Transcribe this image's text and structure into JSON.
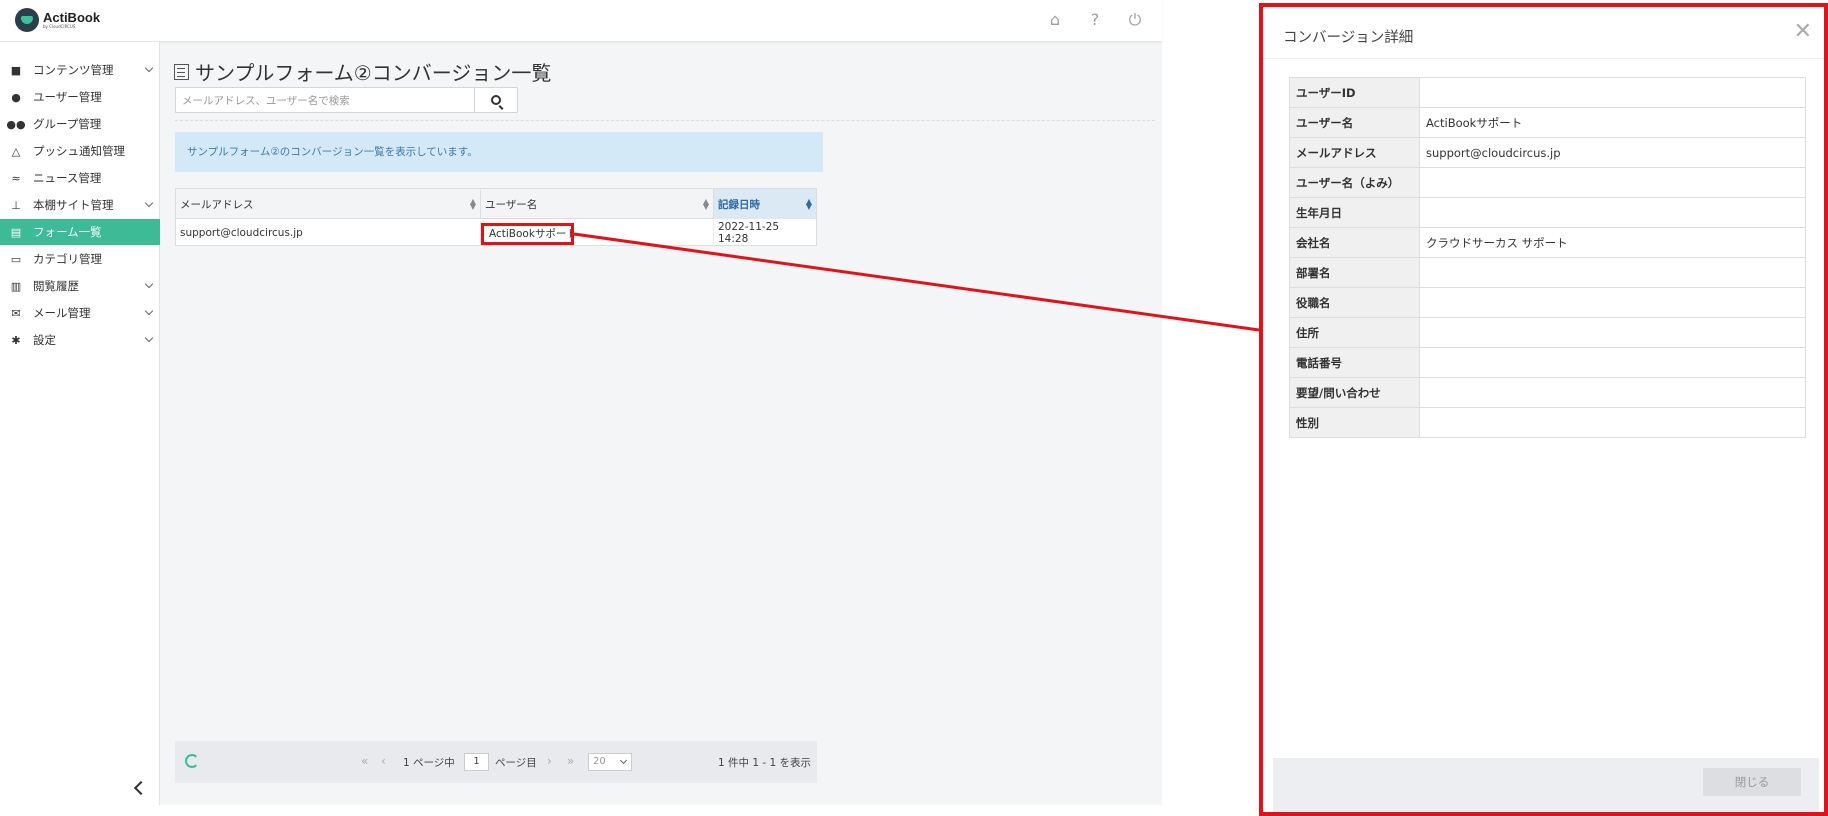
{
  "app": {
    "brand": "ActiBook",
    "brand_sub": "by CloudCIRCUS"
  },
  "topbar_icons": [
    "home-icon",
    "help-icon",
    "power-icon"
  ],
  "sidebar": {
    "items": [
      {
        "label": "コンテンツ管理",
        "icon": "book-icon",
        "expandable": true
      },
      {
        "label": "ユーザー管理",
        "icon": "user-icon",
        "expandable": false
      },
      {
        "label": "グループ管理",
        "icon": "users-icon",
        "expandable": false
      },
      {
        "label": "プッシュ通知管理",
        "icon": "bell-icon",
        "expandable": false
      },
      {
        "label": "ニュース管理",
        "icon": "rss-icon",
        "expandable": false
      },
      {
        "label": "本棚サイト管理",
        "icon": "sitemap-icon",
        "expandable": true
      },
      {
        "label": "フォーム一覧",
        "icon": "form-icon",
        "expandable": false,
        "active": true
      },
      {
        "label": "カテゴリ管理",
        "icon": "folder-icon",
        "expandable": false
      },
      {
        "label": "閲覧履歴",
        "icon": "chart-icon",
        "expandable": true
      },
      {
        "label": "メール管理",
        "icon": "mail-icon",
        "expandable": true
      },
      {
        "label": "設定",
        "icon": "gear-icon",
        "expandable": true
      }
    ]
  },
  "main": {
    "title": "サンプルフォーム②コンバージョン一覧",
    "search_placeholder": "メールアドレス、ユーザー名で検索",
    "info": "サンプルフォーム②のコンバージョン一覧を表示しています。",
    "table": {
      "columns": [
        "メールアドレス",
        "ユーザー名",
        "記録日時"
      ],
      "rows": [
        {
          "email": "support@cloudcircus.jp",
          "username": "ActiBookサポート",
          "recorded": "2022-11-25 14:28"
        }
      ]
    },
    "pager": {
      "page_of": "1 ページ中",
      "page": "1",
      "page_suffix": "ページ目",
      "per_page": "20",
      "summary": "1 件中 1 - 1 を表示"
    }
  },
  "modal": {
    "title": "コンバージョン詳細",
    "fields": [
      {
        "label": "ユーザーID",
        "value": ""
      },
      {
        "label": "ユーザー名",
        "value": "ActiBookサポート"
      },
      {
        "label": "メールアドレス",
        "value": "support@cloudcircus.jp"
      },
      {
        "label": "ユーザー名（よみ）",
        "value": ""
      },
      {
        "label": "生年月日",
        "value": ""
      },
      {
        "label": "会社名",
        "value": "クラウドサーカス サポート"
      },
      {
        "label": "部署名",
        "value": ""
      },
      {
        "label": "役職名",
        "value": ""
      },
      {
        "label": "住所",
        "value": ""
      },
      {
        "label": "電話番号",
        "value": ""
      },
      {
        "label": "要望/問い合わせ",
        "value": ""
      },
      {
        "label": "性別",
        "value": ""
      }
    ],
    "close_label": "閉じる"
  },
  "colors": {
    "accent": "#3dbb96",
    "highlight": "#e0131b",
    "info_bg": "#d4e9f7",
    "link": "#2e6aa1"
  }
}
